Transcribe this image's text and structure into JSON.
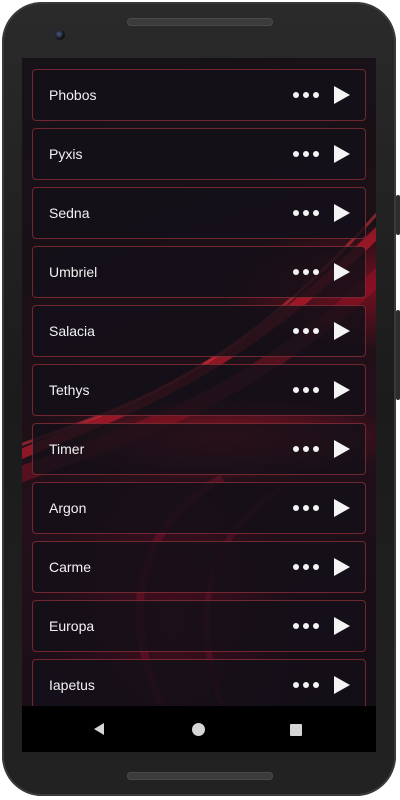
{
  "ringtones": [
    {
      "label": "Phobos"
    },
    {
      "label": "Pyxis"
    },
    {
      "label": "Sedna"
    },
    {
      "label": "Umbriel"
    },
    {
      "label": "Salacia"
    },
    {
      "label": "Tethys"
    },
    {
      "label": "Timer"
    },
    {
      "label": "Argon"
    },
    {
      "label": "Carme"
    },
    {
      "label": "Europa"
    },
    {
      "label": "Iapetus"
    }
  ],
  "icons": {
    "more": "more-options-icon",
    "play": "play-icon",
    "back": "nav-back-icon",
    "home": "nav-home-icon",
    "recent": "nav-recents-icon"
  },
  "colors": {
    "accent": "#c8102e",
    "row_border": "#be3c46",
    "row_background": "#141018",
    "text": "#f2f2f2"
  }
}
